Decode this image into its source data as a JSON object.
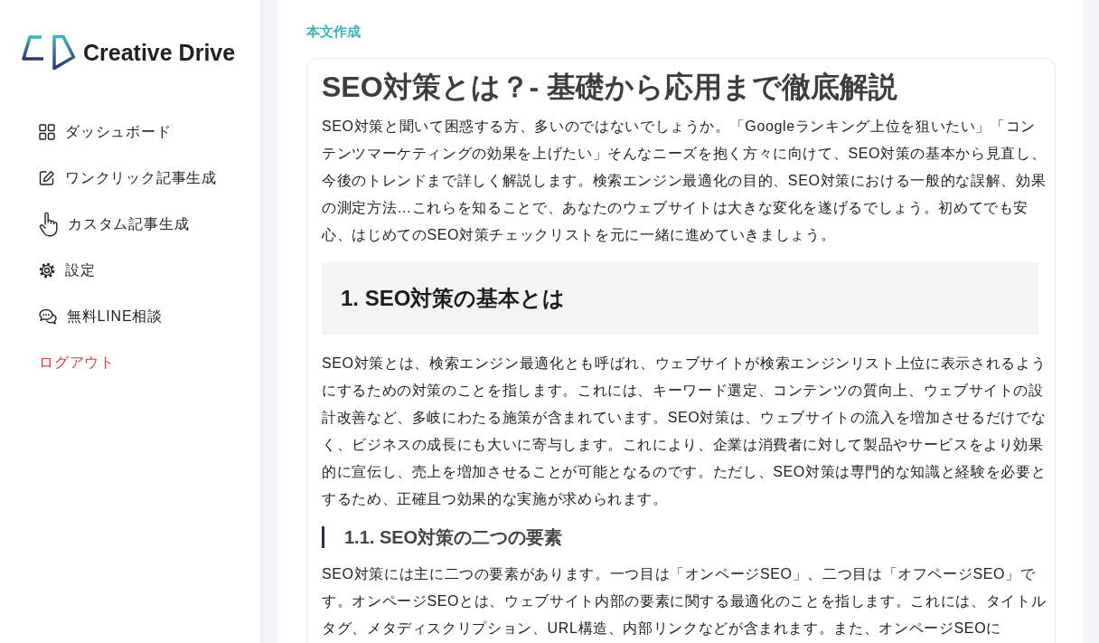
{
  "sidebar": {
    "logo_text": "Creative Drive",
    "menu": [
      {
        "label": "ダッシュボード",
        "kind": "nav"
      },
      {
        "label": "ワンクリック記事生成",
        "kind": "nav"
      },
      {
        "label": "カスタム記事生成",
        "kind": "nav"
      },
      {
        "label": "設定",
        "kind": "nav"
      },
      {
        "label": "無料LINE相談",
        "kind": "nav"
      },
      {
        "label": "ログアウト",
        "kind": "logout"
      }
    ]
  },
  "main": {
    "section_label": "本文作成",
    "article": {
      "title": "SEO対策とは？- 基礎から応用まで徹底解説",
      "blocks": [
        {
          "kind": "paragraph",
          "text": "SEO対策と聞いて困惑する方、多いのではないでしょうか。「Googleランキング上位を狙いたい」「コンテンツマーケティングの効果を上げたい」そんなニーズを抱く方々に向けて、SEO対策の基本から見直し、今後のトレンドまで詳しく解説します。検索エンジン最適化の目的、SEO対策における一般的な誤解、効果の測定方法…これらを知ることで、あなたのウェブサイトは大きな変化を遂げるでしょう。初めてでも安心、はじめてのSEO対策チェックリストを元に一緒に進めていきましょう。"
        },
        {
          "kind": "h2",
          "text": "1. SEO対策の基本とは"
        },
        {
          "kind": "paragraph",
          "text": "SEO対策とは、検索エンジン最適化とも呼ばれ、ウェブサイトが検索エンジンリスト上位に表示されるようにするための対策のことを指します。これには、キーワード選定、コンテンツの質向上、ウェブサイトの設計改善など、多岐にわたる施策が含まれています。SEO対策は、ウェブサイトの流入を増加させるだけでなく、ビジネスの成長にも大いに寄与します。これにより、企業は消費者に対して製品やサービスをより効果的に宣伝し、売上を増加させることが可能となるのです。ただし、SEO対策は専門的な知識と経験を必要とするため、正確且つ効果的な実施が求められます。"
        },
        {
          "kind": "h3",
          "text": "1.1. SEO対策の二つの要素"
        },
        {
          "kind": "paragraph",
          "text": "SEO対策には主に二つの要素があります。一つ目は「オンページSEO」、二つ目は「オフページSEO」です。オンページSEOとは、ウェブサイト内部の要素に関する最適化のことを指します。これには、タイトルタグ、メタディスクリプション、URL構造、内部リンクなどが含まれます。また、オンページSEOに"
        }
      ]
    }
  }
}
